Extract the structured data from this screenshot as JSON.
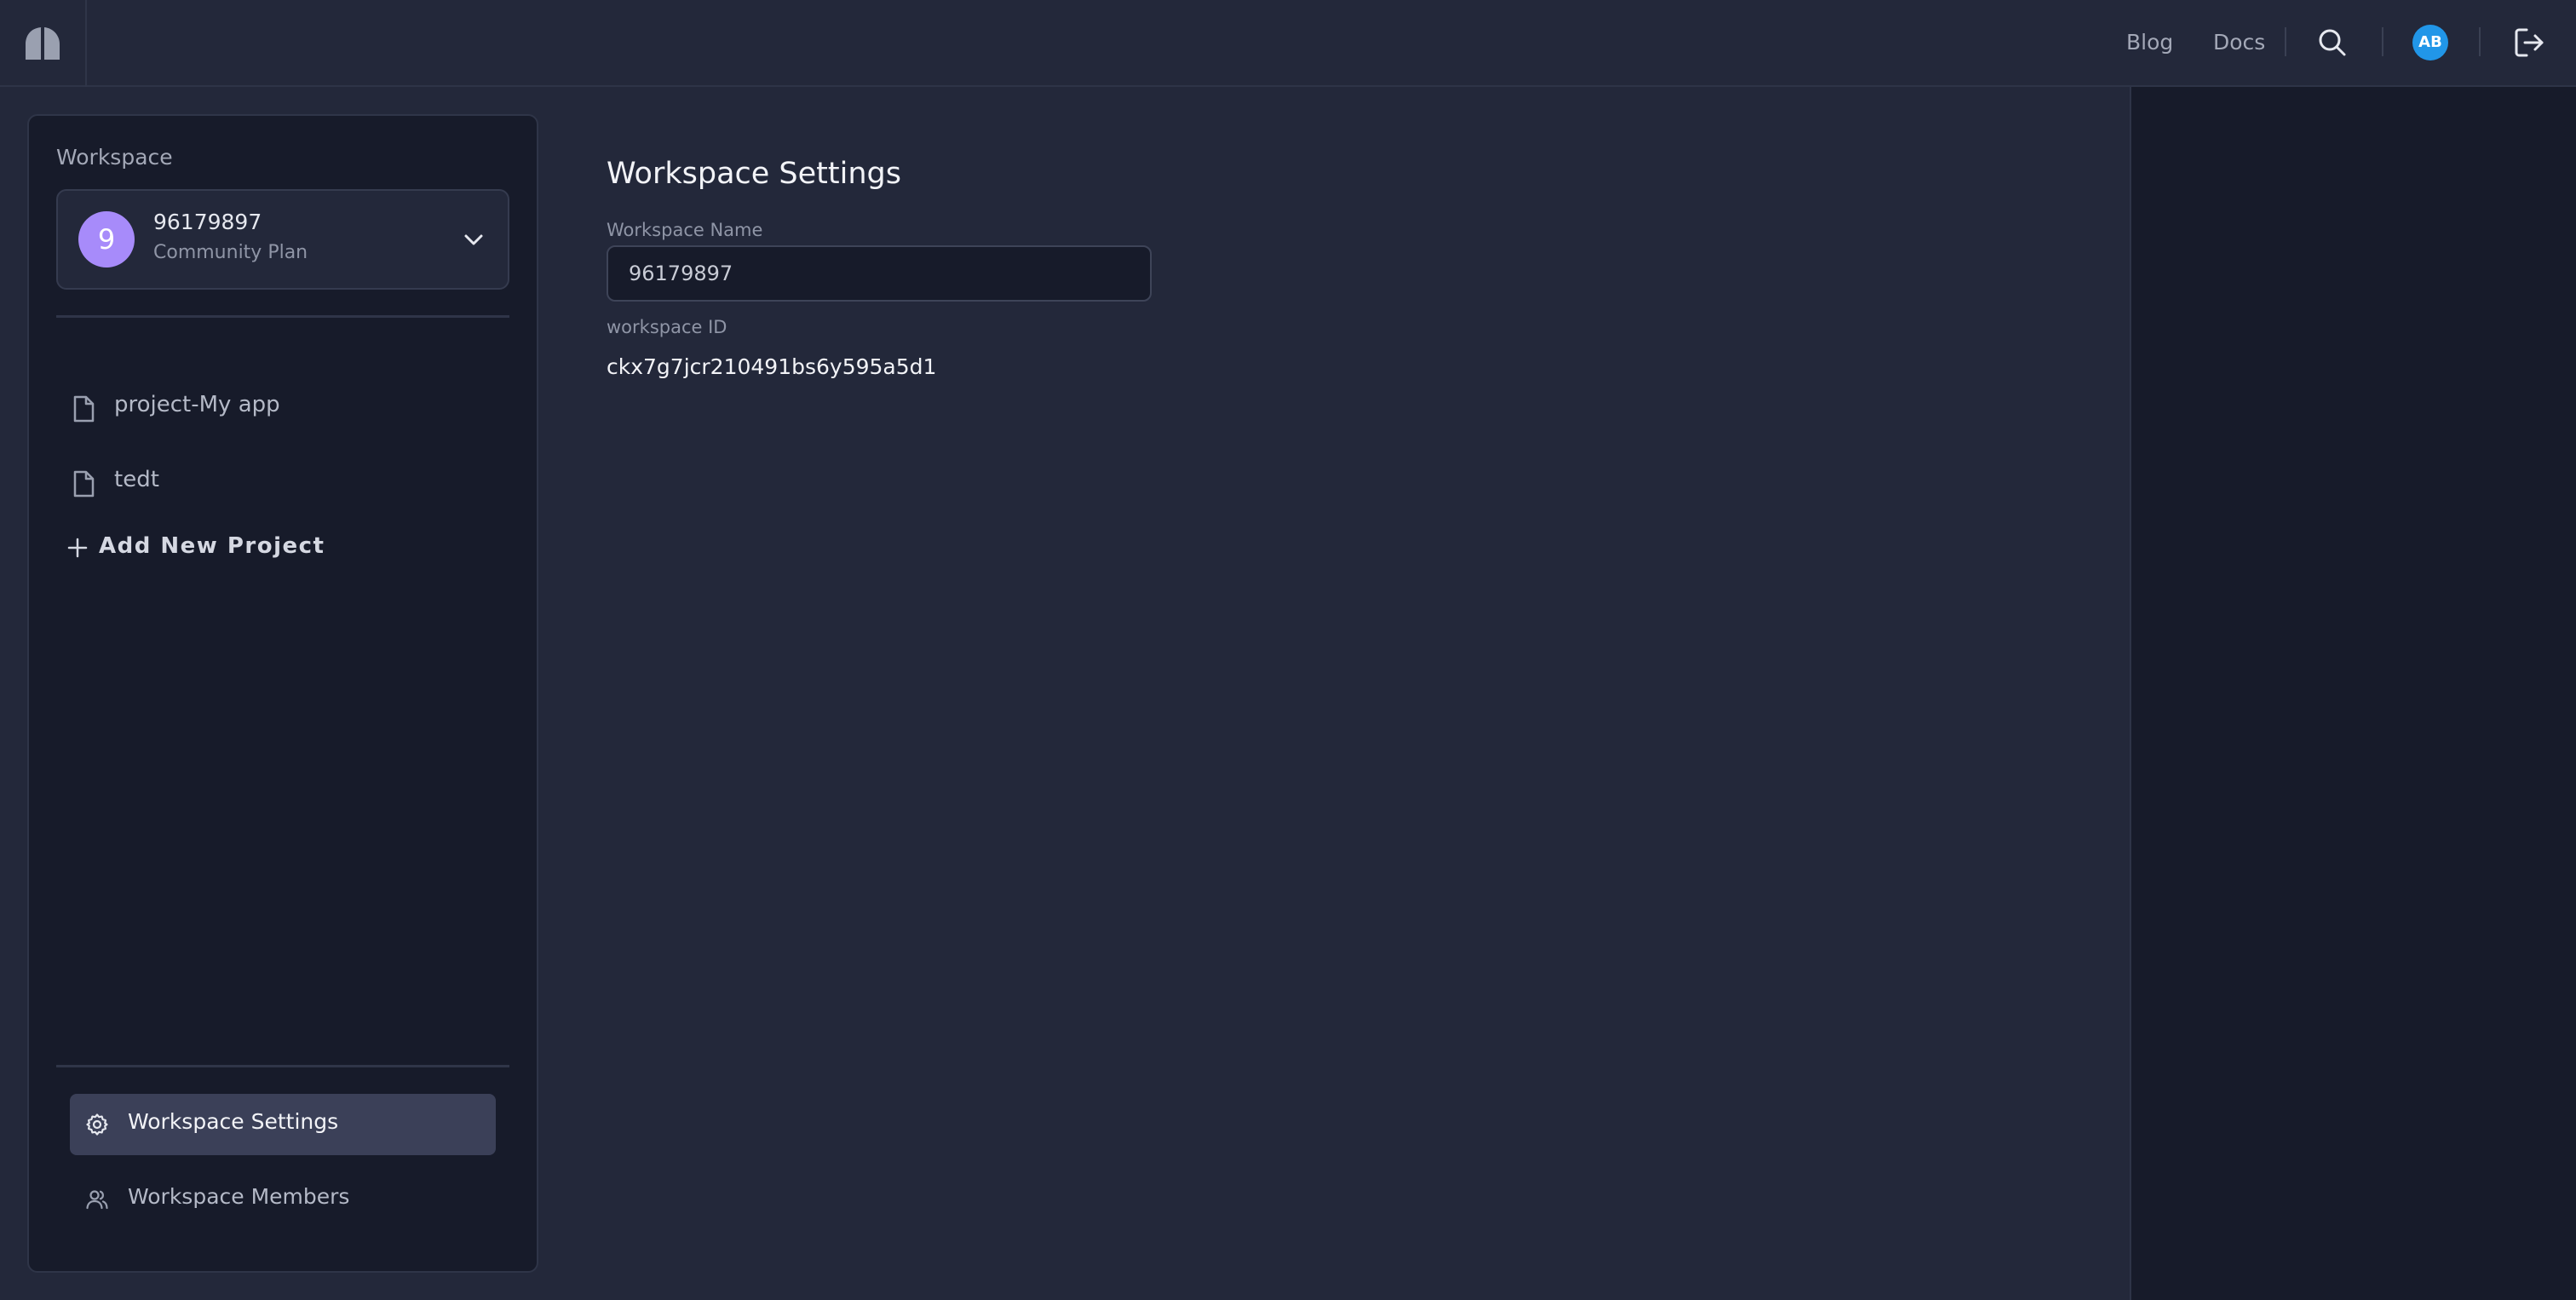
{
  "header": {
    "nav": {
      "blog": "Blog",
      "docs": "Docs"
    },
    "user_initials": "AB",
    "icons": {
      "logo": "app-logo",
      "search": "search-icon",
      "logout": "logout-icon"
    }
  },
  "sidebar": {
    "heading": "Workspace",
    "workspace": {
      "avatar_letter": "9",
      "name": "96179897",
      "plan": "Community Plan"
    },
    "projects": [
      {
        "label": "project-My app",
        "icon": "file-icon"
      },
      {
        "label": "tedt",
        "icon": "file-icon"
      }
    ],
    "add_project_label": "Add New Project",
    "nav": [
      {
        "label": "Workspace Settings",
        "icon": "gear-icon",
        "active": true
      },
      {
        "label": "Workspace Members",
        "icon": "users-icon",
        "active": false
      }
    ]
  },
  "main": {
    "title": "Workspace Settings",
    "name_field": {
      "label": "Workspace Name",
      "value": "96179897"
    },
    "id_field": {
      "label": "workspace ID",
      "value": "ckx7g7jcr210491bs6y595a5d1"
    }
  },
  "colors": {
    "background": "#23283a",
    "panel": "#171b2a",
    "avatar_user": "#2196e8",
    "avatar_workspace": "#a78bfa",
    "active_nav": "#3b4058"
  }
}
